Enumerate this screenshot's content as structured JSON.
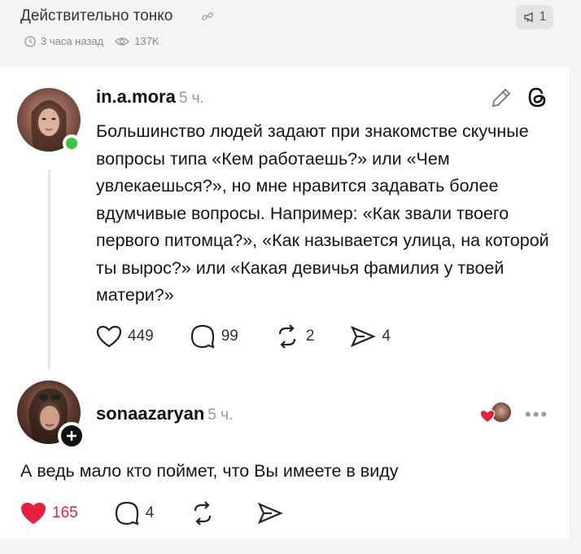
{
  "header": {
    "title": "Действительно тонко",
    "badge_count": "1",
    "time_ago": "3 часа назад",
    "views": "137K"
  },
  "post": {
    "username": "in.a.mora",
    "time": "5 ч.",
    "text": "Большинство людей задают при знакомстве скучные вопросы типа «Кем работаешь?» или «Чем увлекаешься?», но мне нравится задавать более вдумчивые вопросы. Например: «Как звали твоего первого питомца?», «Как называется улица, на которой ты вырос?» или «Какая девичья фамилия у твоей матери?»",
    "likes": "449",
    "comments": "99",
    "reposts": "2",
    "shares": "4"
  },
  "reply": {
    "username": "sonaazaryan",
    "time": "5 ч.",
    "text": "А ведь мало кто поймет, что Вы имеете в виду",
    "likes": "165",
    "comments": "4",
    "menu": "•••"
  },
  "colors": {
    "accent_red": "#e8203d",
    "online_green": "#3cc43c",
    "muted": "#999999"
  },
  "icons": [
    "link-icon",
    "megaphone-icon",
    "clock-icon",
    "eye-icon",
    "edit-icon",
    "threads-icon",
    "heart-icon",
    "comment-icon",
    "repost-icon",
    "share-icon",
    "plus-icon"
  ]
}
